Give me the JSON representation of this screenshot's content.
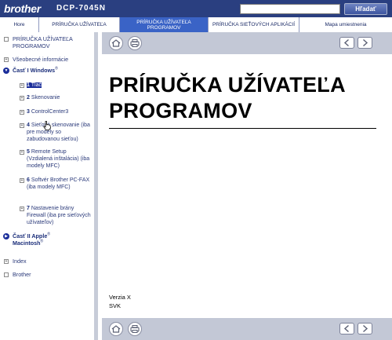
{
  "header": {
    "brand": "brother",
    "model": "DCP-7045N",
    "search_placeholder": "",
    "search_button": "Hľadať"
  },
  "tabs": [
    {
      "label": "Hore",
      "active": false
    },
    {
      "label": "PRÍRUČKA UŽÍVATEĽA",
      "active": false
    },
    {
      "label": "PRÍRUČKA UŽÍVATEĽA PROGRAMOV",
      "active": true
    },
    {
      "label": "PRÍRUČKA SIEŤOVÝCH APLIKÁCIÍ",
      "active": false
    },
    {
      "label": "Mapa umiestnenia",
      "active": false
    }
  ],
  "sidebar": {
    "root": "PRÍRUČKA UŽÍVATEĽA PROGRAMOV",
    "general": "Všeobecné informácie",
    "part1": {
      "label": "Časť I Windows",
      "sup": "®"
    },
    "chapters": [
      {
        "num": "1",
        "label": "Tlač"
      },
      {
        "num": "2",
        "label": "Skenovanie"
      },
      {
        "num": "3",
        "label": "ControlCenter3"
      },
      {
        "num": "4",
        "label": "Sieťové skenovanie (iba pre modely so zabudovanou sieťou)"
      },
      {
        "num": "5",
        "label": "Remote Setup (Vzdialená inštalácia) (iba modely MFC)"
      },
      {
        "num": "6",
        "label": "Softvér Brother PC-FAX (iba modely MFC)"
      },
      {
        "num": "7",
        "label": "Nastavenie brány Firewall (iba pre sieťových užívateľov)"
      }
    ],
    "part2": {
      "label_a": "Časť II Apple",
      "sup_a": "®",
      "label_b": "Macintosh",
      "sup_b": "®"
    },
    "index": "Index",
    "brother": "Brother"
  },
  "document": {
    "title_line1": "PRÍRUČKA UŽÍVATEĽA",
    "title_line2": "PROGRAMOV",
    "version": "Verzia X",
    "language": "SVK"
  },
  "icons": {
    "home": "home-icon",
    "print": "printer-icon",
    "prev": "arrow-left-icon",
    "next": "arrow-right-icon"
  },
  "colors": {
    "header_bg": "#2a3f80",
    "active_tab": "#3a63c6",
    "nav_bar": "#c3c8d6",
    "link": "#2b3a7a"
  }
}
